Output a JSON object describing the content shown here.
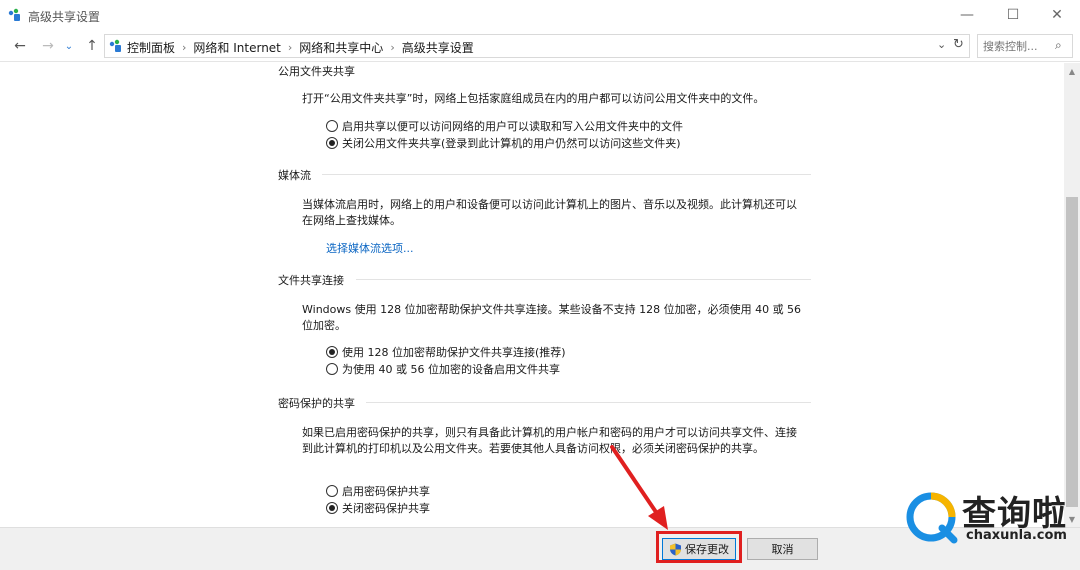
{
  "window": {
    "title": "高级共享设置",
    "controls": {
      "minimize": "—",
      "maximize": "☐",
      "close": "✕"
    }
  },
  "nav": {
    "back": "←",
    "forward": "→",
    "recent": "⌄",
    "up": "↑",
    "breadcrumbs": [
      "控制面板",
      "网络和 Internet",
      "网络和共享中心",
      "高级共享设置"
    ],
    "separator": "›",
    "dropdown": "⌄",
    "refresh": "↻",
    "search_placeholder": "搜索控制...",
    "search_icon": "⌕"
  },
  "sections": {
    "public_folder": {
      "heading": "公用文件夹共享",
      "description": "打开“公用文件夹共享”时，网络上包括家庭组成员在内的用户都可以访问公用文件夹中的文件。",
      "options": [
        {
          "label": "启用共享以便可以访问网络的用户可以读取和写入公用文件夹中的文件",
          "checked": false
        },
        {
          "label": "关闭公用文件夹共享(登录到此计算机的用户仍然可以访问这些文件夹)",
          "checked": true
        }
      ]
    },
    "media": {
      "heading": "媒体流",
      "description": "当媒体流启用时，网络上的用户和设备便可以访问此计算机上的图片、音乐以及视频。此计算机还可以在网络上查找媒体。",
      "link": "选择媒体流选项..."
    },
    "file_sharing": {
      "heading": "文件共享连接",
      "description": "Windows 使用 128 位加密帮助保护文件共享连接。某些设备不支持 128 位加密，必须使用 40 或 56 位加密。",
      "options": [
        {
          "label": "使用 128 位加密帮助保护文件共享连接(推荐)",
          "checked": true
        },
        {
          "label": "为使用 40 或 56 位加密的设备启用文件共享",
          "checked": false
        }
      ]
    },
    "password": {
      "heading": "密码保护的共享",
      "description": "如果已启用密码保护的共享，则只有具备此计算机的用户帐户和密码的用户才可以访问共享文件、连接到此计算机的打印机以及公用文件夹。若要使其他人具备访问权限，必须关闭密码保护的共享。",
      "options": [
        {
          "label": "启用密码保护共享",
          "checked": false
        },
        {
          "label": "关闭密码保护共享",
          "checked": true
        }
      ]
    }
  },
  "footer": {
    "save_label": "保存更改",
    "cancel_label": "取消"
  },
  "colors": {
    "link": "#0b66c3",
    "highlight": "#e02020",
    "accent": "#0078d7"
  }
}
